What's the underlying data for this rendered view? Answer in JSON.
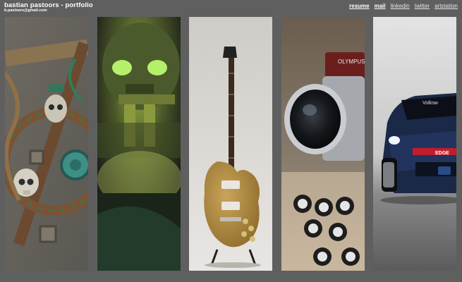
{
  "header": {
    "title": "bastian pastoors - portfolio",
    "email": "b.pastoors@gmail.com"
  },
  "nav": [
    {
      "label": "resume",
      "active": true
    },
    {
      "label": "mail",
      "active": true
    },
    {
      "label": "linkedin",
      "active": false
    },
    {
      "label": "twitter",
      "active": false
    },
    {
      "label": "artstation",
      "active": false
    }
  ],
  "panels": [
    {
      "subject": "pirate-ship-wheel-render"
    },
    {
      "subject": "glowing-skull-render"
    },
    {
      "subject": "gold-electric-guitar-render"
    },
    {
      "subject": "camera-lens-tripod-render"
    },
    {
      "subject": "rally-car-render"
    }
  ],
  "panel_lettering": {
    "camera_brand": "OLYMPUS",
    "car_brand": "Volksw",
    "car_sponsor": "EDGE"
  },
  "colors": {
    "page_background": "#5f5f5f",
    "text": "#ffffff"
  }
}
